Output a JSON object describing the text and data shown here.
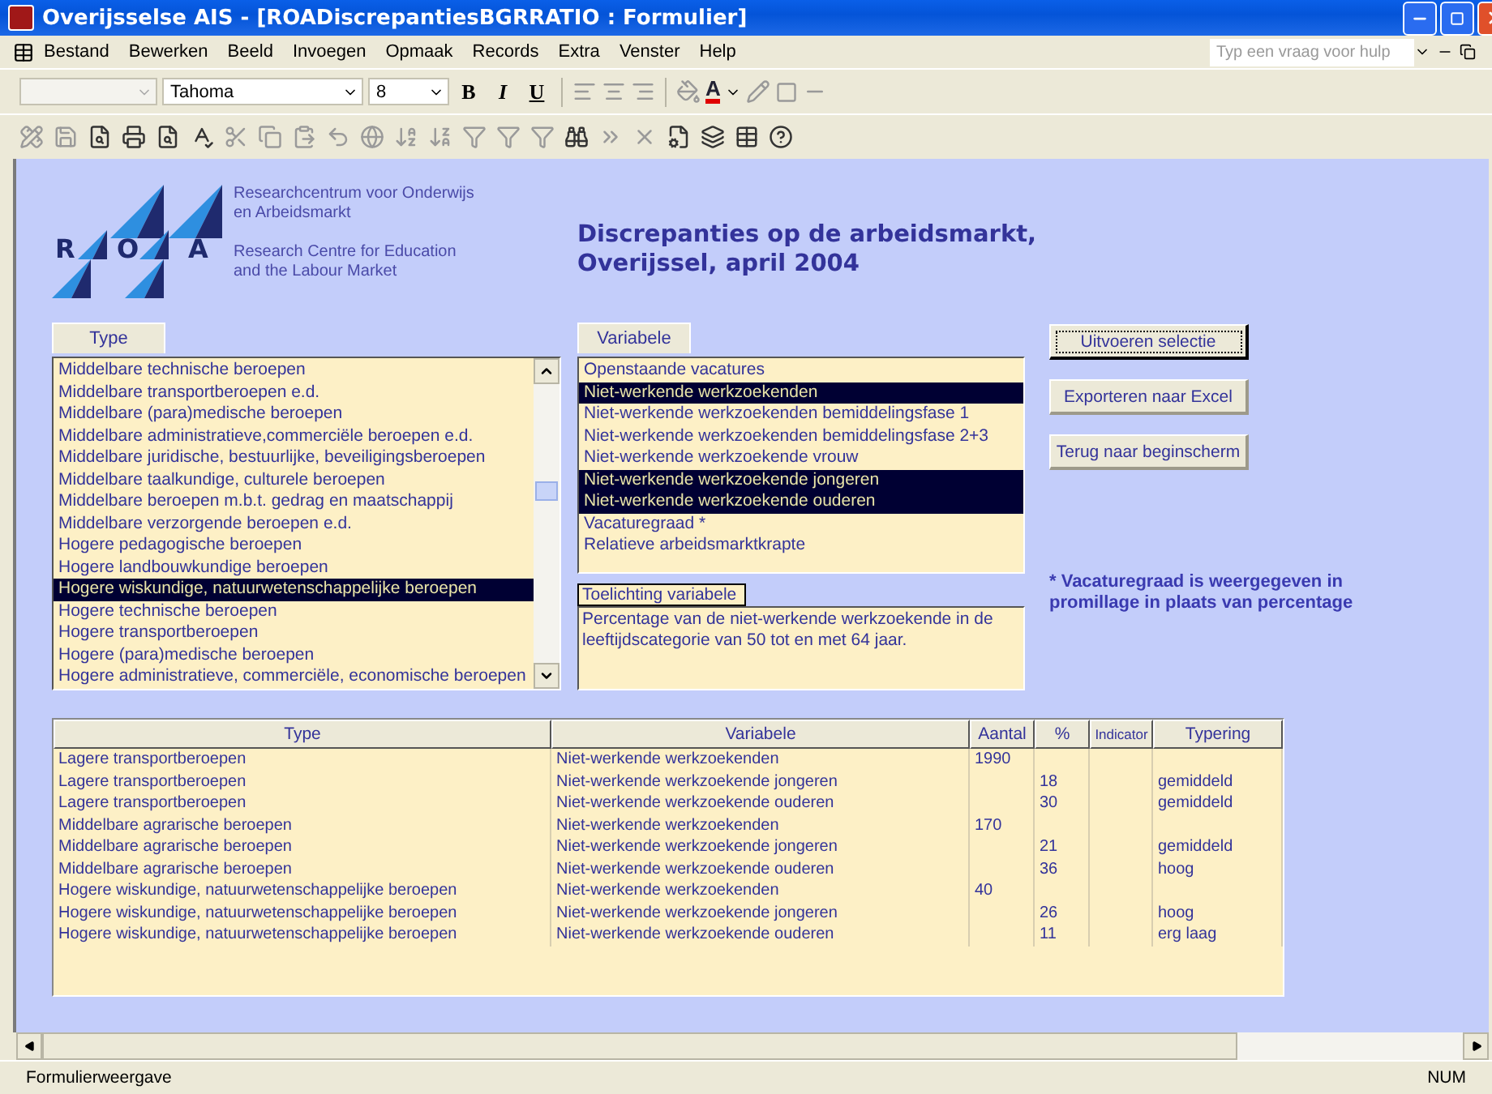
{
  "window": {
    "title": "Overijsselse AIS - [ROADiscrepantiesBGRRATIO : Formulier]"
  },
  "menu": [
    "Bestand",
    "Bewerken",
    "Beeld",
    "Invoegen",
    "Opmaak",
    "Records",
    "Extra",
    "Venster",
    "Help"
  ],
  "help_field": {
    "placeholder": "Typ een vraag voor hulp"
  },
  "format_toolbar": {
    "font": "Tahoma",
    "size": "8",
    "bold": "B",
    "italic": "I",
    "underline": "U",
    "font_color": "A"
  },
  "header": {
    "logo_letters": [
      "R",
      "O",
      "A"
    ],
    "org_nl": "Researchcentrum voor Onderwijs\nen Arbeidsmarkt",
    "org_en": "Research Centre for Education\nand the Labour Market",
    "title": "Discrepanties op de arbeidsmarkt,\nOverijssel, april 2004"
  },
  "type_list": {
    "label": "Type",
    "items": [
      {
        "text": "Middelbare technische beroepen",
        "selected": false
      },
      {
        "text": "Middelbare transportberoepen e.d.",
        "selected": false
      },
      {
        "text": "Middelbare (para)medische beroepen",
        "selected": false
      },
      {
        "text": "Middelbare administratieve,commerciële beroepen e.d.",
        "selected": false
      },
      {
        "text": "Middelbare juridische, bestuurlijke, beveiligingsberoepen",
        "selected": false
      },
      {
        "text": "Middelbare taalkundige, culturele beroepen",
        "selected": false
      },
      {
        "text": "Middelbare beroepen m.b.t. gedrag en maatschappij",
        "selected": false
      },
      {
        "text": "Middelbare verzorgende beroepen e.d.",
        "selected": false
      },
      {
        "text": "Hogere pedagogische beroepen",
        "selected": false
      },
      {
        "text": "Hogere landbouwkundige beroepen",
        "selected": false
      },
      {
        "text": "Hogere wiskundige, natuurwetenschappelijke beroepen",
        "selected": true
      },
      {
        "text": "Hogere technische beroepen",
        "selected": false
      },
      {
        "text": "Hogere transportberoepen",
        "selected": false
      },
      {
        "text": "Hogere (para)medische beroepen",
        "selected": false
      },
      {
        "text": "Hogere administratieve, commerciële, economische beroepen",
        "selected": false
      }
    ]
  },
  "variable_list": {
    "label": "Variabele",
    "items": [
      {
        "text": "Openstaande vacatures",
        "selected": false
      },
      {
        "text": "Niet-werkende werkzoekenden",
        "selected": true
      },
      {
        "text": "Niet-werkende werkzoekenden bemiddelingsfase 1",
        "selected": false
      },
      {
        "text": "Niet-werkende werkzoekenden bemiddelingsfase 2+3",
        "selected": false
      },
      {
        "text": "Niet-werkende werkzoekende vrouw",
        "selected": false
      },
      {
        "text": "Niet-werkende werkzoekende jongeren",
        "selected": true
      },
      {
        "text": "Niet-werkende werkzoekende ouderen",
        "selected": true
      },
      {
        "text": "Vacaturegraad *",
        "selected": false
      },
      {
        "text": "Relatieve arbeidsmarktkrapte",
        "selected": false
      }
    ]
  },
  "explanation": {
    "label": "Toelichting variabele",
    "text": "Percentage van de niet-werkende werkzoekende in de\nleeftijdscategorie van 50 tot en met 64 jaar."
  },
  "buttons": [
    {
      "label": "Uitvoeren selectie",
      "focused": true
    },
    {
      "label": "Exporteren naar Excel",
      "focused": false
    },
    {
      "label": "Terug naar beginscherm",
      "focused": false
    }
  ],
  "note": "* Vacaturegraad is weergegeven in\npromillage in plaats van percentage",
  "table": {
    "columns": [
      "Type",
      "Variabele",
      "Aantal",
      "%",
      "Indicator",
      "Typering"
    ],
    "rows": [
      {
        "type": "Lagere transportberoepen",
        "variable": "Niet-werkende werkzoekenden",
        "count": "1990"
      },
      {
        "type": "Lagere transportberoepen",
        "variable": "Niet-werkende werkzoekende jongeren",
        "percent": "18",
        "typering": "gemiddeld"
      },
      {
        "type": "Lagere transportberoepen",
        "variable": "Niet-werkende werkzoekende ouderen",
        "percent": "30",
        "typering": "gemiddeld"
      },
      {
        "type": "Middelbare agrarische beroepen",
        "variable": "Niet-werkende werkzoekenden",
        "count": "170"
      },
      {
        "type": "Middelbare agrarische beroepen",
        "variable": "Niet-werkende werkzoekende jongeren",
        "percent": "21",
        "typering": "gemiddeld"
      },
      {
        "type": "Middelbare agrarische beroepen",
        "variable": "Niet-werkende werkzoekende ouderen",
        "percent": "36",
        "typering": "hoog"
      },
      {
        "type": "Hogere wiskundige, natuurwetenschappelijke beroepen",
        "variable": "Niet-werkende werkzoekenden",
        "count": "40"
      },
      {
        "type": "Hogere wiskundige, natuurwetenschappelijke beroepen",
        "variable": "Niet-werkende werkzoekende jongeren",
        "percent": "26",
        "typering": "hoog"
      },
      {
        "type": "Hogere wiskundige, natuurwetenschappelijke beroepen",
        "variable": "Niet-werkende werkzoekende ouderen",
        "percent": "11",
        "typering": "erg laag"
      }
    ]
  },
  "status_bar": {
    "text": "Formulierweergave",
    "mode": "NUM"
  }
}
